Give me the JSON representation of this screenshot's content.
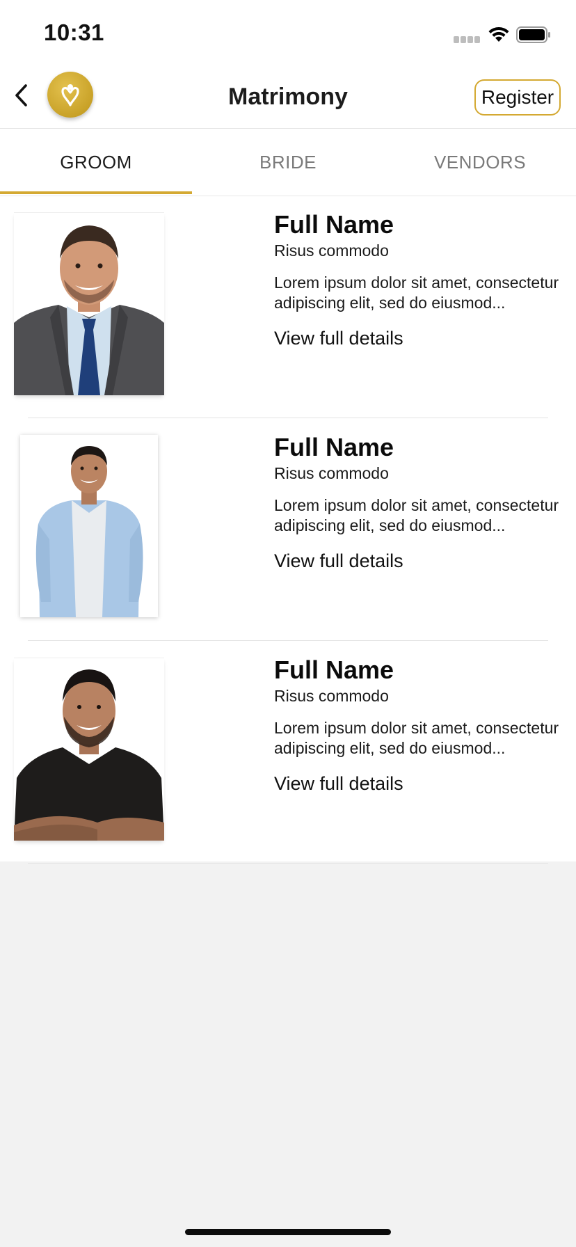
{
  "status_bar": {
    "time": "10:31"
  },
  "nav": {
    "title": "Matrimony",
    "register_label": "Register",
    "back_icon": "chevron-left-icon",
    "logo_icon": "heart-figure-logo"
  },
  "tabs": [
    {
      "label": "GROOM",
      "active": true
    },
    {
      "label": "BRIDE",
      "active": false
    },
    {
      "label": "VENDORS",
      "active": false
    }
  ],
  "profiles": [
    {
      "name": "Full Name",
      "subtitle": "Risus commodo",
      "description": "Lorem ipsum dolor sit amet, consectetur adipiscing elit, sed do eiusmod...",
      "link": "View full details",
      "photo": "man-in-suit-and-tie"
    },
    {
      "name": "Full Name",
      "subtitle": "Risus commodo",
      "description": "Lorem ipsum dolor sit amet, consectetur adipiscing elit, sed do eiusmod...",
      "link": "View full details",
      "photo": "man-in-blue-shirt"
    },
    {
      "name": "Full Name",
      "subtitle": "Risus commodo",
      "description": "Lorem ipsum dolor sit amet, consectetur adipiscing elit, sed do eiusmod...",
      "link": "View full details",
      "photo": "man-in-black-tshirt"
    }
  ],
  "colors": {
    "accent": "#d4a932",
    "background": "#f2f2f2",
    "surface": "#ffffff"
  }
}
